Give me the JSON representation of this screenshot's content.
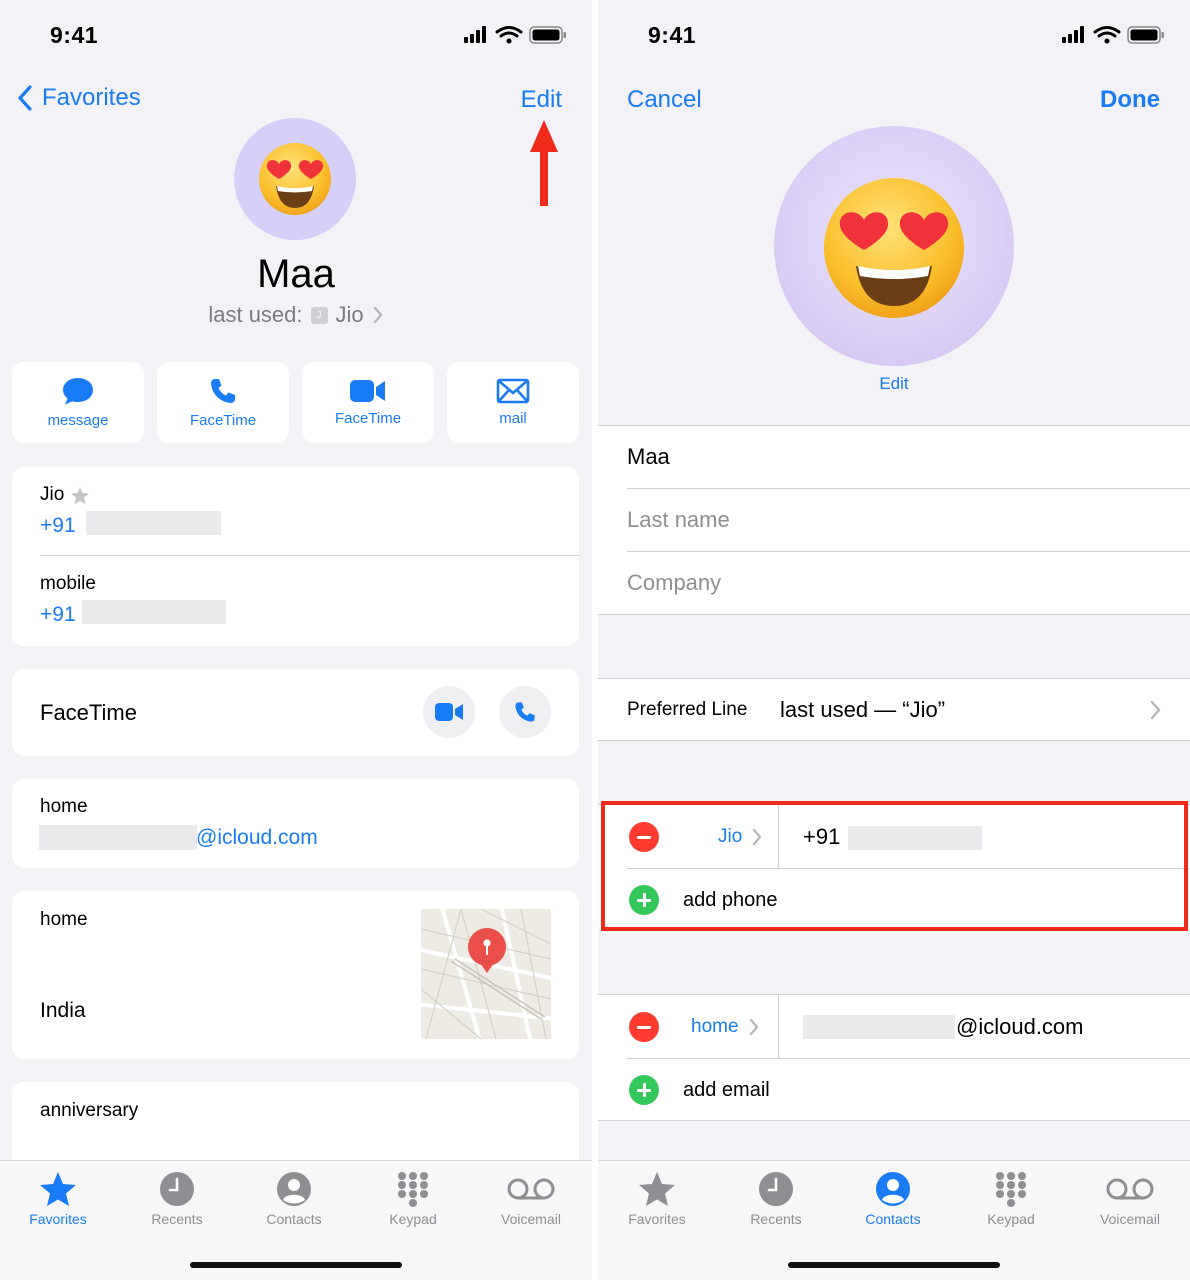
{
  "left": {
    "status_time": "9:41",
    "nav": {
      "back_label": "Favorites",
      "edit_label": "Edit"
    },
    "contact": {
      "name": "Maa",
      "last_used_prefix": "last used:",
      "last_used_sim_badge": "J",
      "last_used_carrier": "Jio"
    },
    "actions": [
      {
        "label": "message",
        "icon": "message-icon"
      },
      {
        "label": "FaceTime",
        "icon": "phone-icon"
      },
      {
        "label": "FaceTime",
        "icon": "video-icon"
      },
      {
        "label": "mail",
        "icon": "mail-icon"
      }
    ],
    "phones": [
      {
        "label": "Jio",
        "prefix": "+91 ",
        "star_icon": "star-icon"
      },
      {
        "label": "mobile",
        "prefix": "+91"
      }
    ],
    "facetime": {
      "label": "FaceTime"
    },
    "email": {
      "label": "home",
      "domain": "@icloud.com"
    },
    "address": {
      "label": "home",
      "country": "India"
    },
    "anniversary": {
      "label": "anniversary"
    },
    "tabs": [
      {
        "label": "Favorites",
        "icon": "star-icon",
        "active": true
      },
      {
        "label": "Recents",
        "icon": "clock-icon",
        "active": false
      },
      {
        "label": "Contacts",
        "icon": "person-icon",
        "active": false
      },
      {
        "label": "Keypad",
        "icon": "keypad-icon",
        "active": false
      },
      {
        "label": "Voicemail",
        "icon": "voicemail-icon",
        "active": false
      }
    ]
  },
  "right": {
    "status_time": "9:41",
    "nav": {
      "cancel_label": "Cancel",
      "done_label": "Done"
    },
    "edit_photo_label": "Edit",
    "fields": {
      "first_name": "Maa",
      "last_name_placeholder": "Last name",
      "company_placeholder": "Company"
    },
    "preferred_line": {
      "label": "Preferred Line",
      "value": "last used — “Jio”"
    },
    "phone_entry": {
      "type_label": "Jio",
      "value_prefix": "+91"
    },
    "add_phone_label": "add phone",
    "email_entry": {
      "type_label": "home",
      "value_suffix": "@icloud.com"
    },
    "add_email_label": "add email",
    "tabs": [
      {
        "label": "Favorites",
        "icon": "star-icon",
        "active": false
      },
      {
        "label": "Recents",
        "icon": "clock-icon",
        "active": false
      },
      {
        "label": "Contacts",
        "icon": "person-icon",
        "active": true
      },
      {
        "label": "Keypad",
        "icon": "keypad-icon",
        "active": false
      },
      {
        "label": "Voicemail",
        "icon": "voicemail-icon",
        "active": false
      }
    ]
  },
  "colors": {
    "accent": "#1a7cf5",
    "delete": "#ff3b30",
    "add": "#34c759",
    "annotation": "#ee2a1a",
    "avatar": "#d6cff8"
  }
}
